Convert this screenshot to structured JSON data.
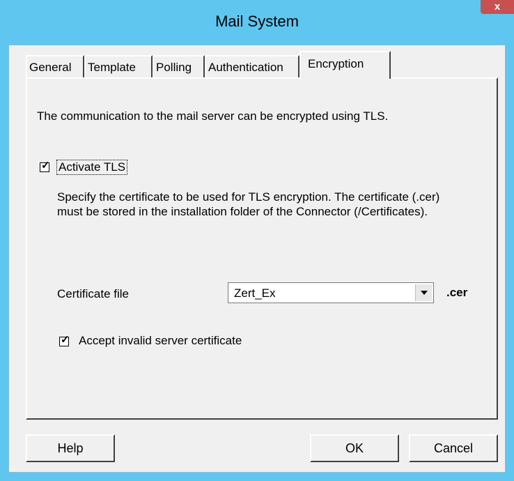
{
  "window": {
    "title": "Mail System",
    "close_label": "x"
  },
  "tabs": [
    {
      "label": "General",
      "active": false
    },
    {
      "label": "Template",
      "active": false
    },
    {
      "label": "Polling",
      "active": false
    },
    {
      "label": "Authentication",
      "active": false
    },
    {
      "label": "Encryption",
      "active": true
    }
  ],
  "encryption": {
    "intro": "The communication to the mail server can be encrypted using TLS.",
    "activate_tls": {
      "label": "Activate TLS",
      "checked": true
    },
    "description": "Specify the certificate to be used for TLS encryption. The certificate (.cer) must be stored in the installation folder of the Connector (/Certificates).",
    "certificate_label": "Certificate file",
    "certificate_value": "Zert_Ex",
    "certificate_suffix": ".cer",
    "accept_invalid": {
      "label": "Accept invalid server certificate",
      "checked": true
    }
  },
  "buttons": {
    "help": "Help",
    "ok": "OK",
    "cancel": "Cancel"
  },
  "colors": {
    "frame": "#5ec6ef",
    "close": "#c75050",
    "dialog_bg": "#f0f0f0"
  }
}
